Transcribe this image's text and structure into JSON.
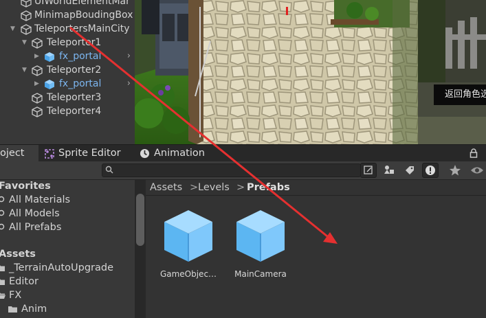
{
  "hierarchy": {
    "items": [
      {
        "label": "UIWorldElementMar",
        "fold": "",
        "prefab": false,
        "chevron": false
      },
      {
        "label": "MinimapBoudingBox",
        "fold": "",
        "prefab": false,
        "chevron": false
      },
      {
        "label": "TeleportersMainCity",
        "fold": "▼",
        "prefab": false,
        "chevron": false
      },
      {
        "label": "Teleporter1",
        "fold": "▼",
        "prefab": false,
        "chevron": false
      },
      {
        "label": "fx_portal",
        "fold": "▶",
        "prefab": true,
        "chevron": true
      },
      {
        "label": "Teleporter2",
        "fold": "▼",
        "prefab": false,
        "chevron": false
      },
      {
        "label": "fx_portal",
        "fold": "▶",
        "prefab": true,
        "chevron": true
      },
      {
        "label": "Teleporter3",
        "fold": "",
        "prefab": false,
        "chevron": false
      },
      {
        "label": "Teleporter4",
        "fold": "",
        "prefab": false,
        "chevron": false
      }
    ]
  },
  "game_view": {
    "label": "返回角色选"
  },
  "tabs": [
    {
      "label": "oject",
      "icon": "project-icon"
    },
    {
      "label": "Sprite Editor",
      "icon": "sprite-editor-icon"
    },
    {
      "label": "Animation",
      "icon": "animation-icon"
    }
  ],
  "search": {
    "placeholder": "",
    "value": ""
  },
  "favorites": {
    "heading": "Favorites",
    "items": [
      "All Materials",
      "All Models",
      "All Prefabs"
    ]
  },
  "assets_tree": {
    "heading": "Assets",
    "items": [
      {
        "label": "_TerrainAutoUpgrade",
        "indent": 0
      },
      {
        "label": "Editor",
        "indent": 0
      },
      {
        "label": "FX",
        "indent": 0
      },
      {
        "label": "Anim",
        "indent": 1
      }
    ]
  },
  "breadcrumb": {
    "items": [
      "Assets",
      "Levels",
      "Prefabs"
    ],
    "separator": ">"
  },
  "assets": [
    {
      "label": "GameObjec…",
      "icon": "prefab-cube-icon"
    },
    {
      "label": "MainCamera",
      "icon": "prefab-cube-icon"
    }
  ],
  "colors": {
    "prefab_blue": "#7cb6f0",
    "arrow_red": "#e53030",
    "panel_bg": "#383838"
  }
}
